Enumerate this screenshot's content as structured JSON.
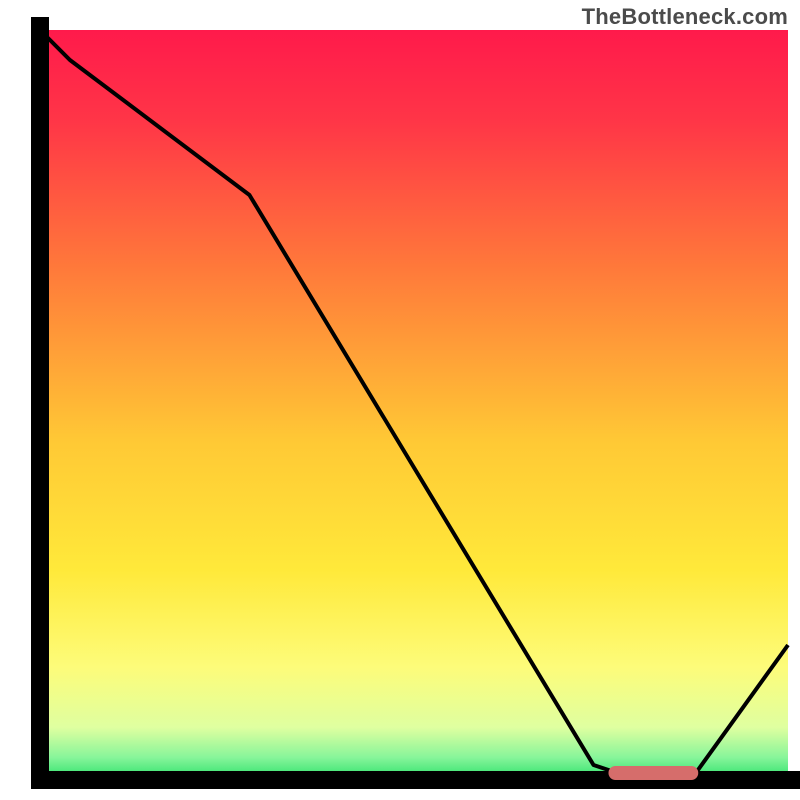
{
  "watermark": "TheBottleneck.com",
  "chart_data": {
    "type": "line",
    "title": "",
    "xlabel": "",
    "ylabel": "",
    "xlim": [
      0,
      100
    ],
    "ylim": [
      0,
      100
    ],
    "x": [
      0,
      4,
      28,
      74,
      80,
      87,
      100
    ],
    "values": [
      100,
      96,
      78,
      2,
      0,
      0,
      18
    ],
    "optimum_band": {
      "x_start": 76,
      "x_end": 88,
      "y": 0
    },
    "gradient_stops": [
      {
        "pct": 0,
        "color": "#ff1a4b"
      },
      {
        "pct": 12,
        "color": "#ff3547"
      },
      {
        "pct": 32,
        "color": "#ff7a3a"
      },
      {
        "pct": 55,
        "color": "#ffc935"
      },
      {
        "pct": 72,
        "color": "#ffe93a"
      },
      {
        "pct": 85,
        "color": "#fdfc7a"
      },
      {
        "pct": 93,
        "color": "#dfffa0"
      },
      {
        "pct": 97,
        "color": "#87f59a"
      },
      {
        "pct": 100,
        "color": "#29e06a"
      }
    ],
    "axis_color": "#000000",
    "curve_color": "#000000",
    "optimum_color": "#d66d6b"
  }
}
